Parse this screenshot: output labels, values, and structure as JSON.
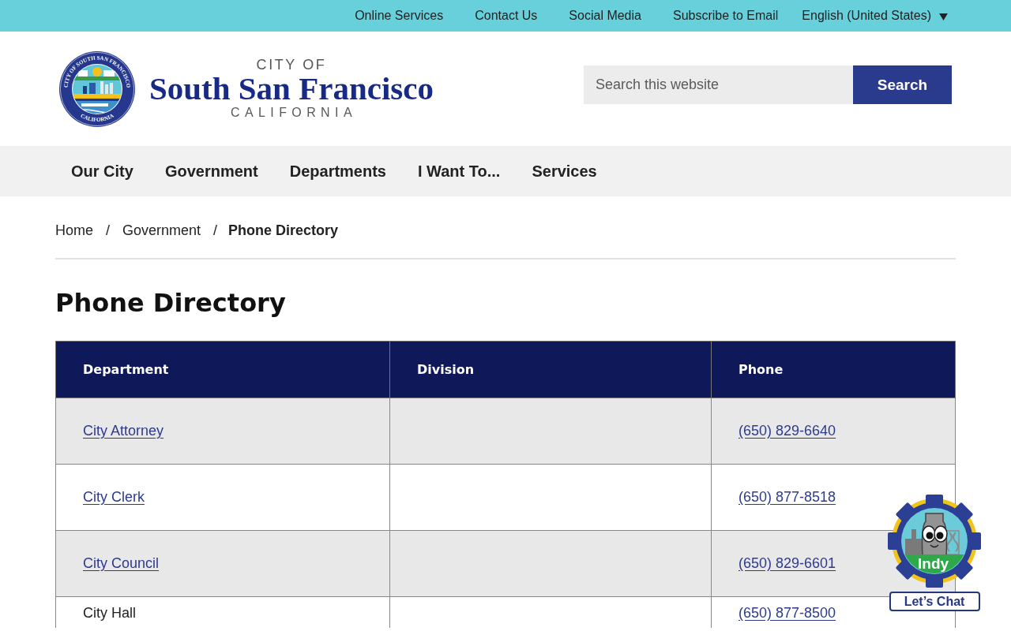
{
  "top_bar": {
    "links": [
      "Online Services",
      "Contact Us",
      "Social Media",
      "Subscribe to Email"
    ],
    "language": "English (United States)"
  },
  "header": {
    "seal": {
      "ring_top": "CITY OF SOUTH SAN FRANCISCO",
      "ring_bottom": "CALIFORNIA"
    },
    "wordmark": {
      "prefix": "CITY OF",
      "name": "South San Francisco",
      "state": "CALIFORNIA"
    },
    "search": {
      "placeholder": "Search this website",
      "button": "Search"
    }
  },
  "nav": {
    "items": [
      "Our City",
      "Government",
      "Departments",
      "I Want To...",
      "Services"
    ]
  },
  "breadcrumb": {
    "items": [
      {
        "label": "Home",
        "current": false,
        "separator": "/"
      },
      {
        "label": "Government",
        "current": false,
        "separator": "/"
      },
      {
        "label": "Phone Directory",
        "current": true
      }
    ]
  },
  "title": "Phone Directory",
  "table": {
    "columns": [
      "Department",
      "Division",
      "Phone"
    ],
    "rows": [
      {
        "department": {
          "text": "City Attorney",
          "link": true
        },
        "phone": {
          "text": "(650) 829-6640",
          "link": true
        }
      },
      {
        "department": {
          "text": "City Clerk",
          "link": true
        },
        "phone": {
          "text": "(650) 877-8518",
          "link": true
        }
      },
      {
        "department": {
          "text": "City Council",
          "link": true
        },
        "phone": {
          "text": "(650) 829-6601",
          "link": true
        }
      },
      {
        "department": {
          "text": "City Hall",
          "link": false
        },
        "phone": {
          "text": "(650) 877-8500",
          "link": true
        }
      }
    ]
  },
  "chat": {
    "name": "Indy",
    "button": "Let’s Chat"
  }
}
